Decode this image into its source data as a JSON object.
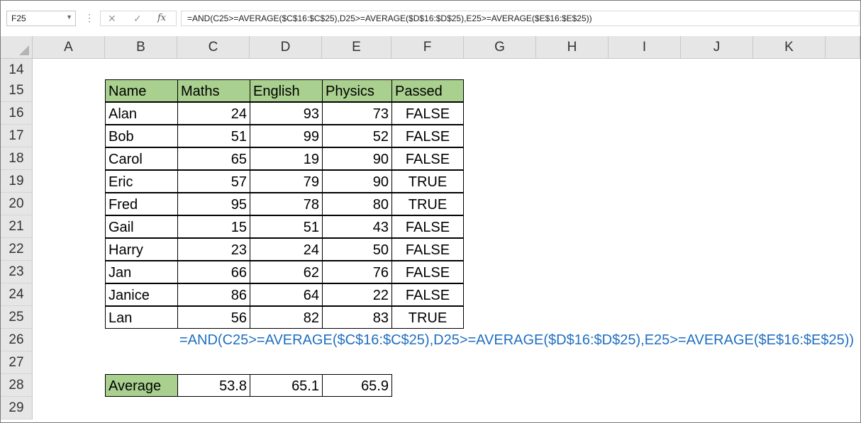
{
  "formula_bar": {
    "name_box": "F25",
    "cancel_glyph": "✕",
    "enter_glyph": "✓",
    "fx_label": "fx",
    "formula": "=AND(C25>=AVERAGE($C$16:$C$25),D25>=AVERAGE($D$16:$D$25),E25>=AVERAGE($E$16:$E$25))"
  },
  "columns": [
    "A",
    "B",
    "C",
    "D",
    "E",
    "F",
    "G",
    "H",
    "I",
    "J",
    "K"
  ],
  "rows": [
    "14",
    "15",
    "16",
    "17",
    "18",
    "19",
    "20",
    "21",
    "22",
    "23",
    "24",
    "25",
    "26",
    "27",
    "28",
    "29"
  ],
  "table": {
    "headers": [
      "Name",
      "Maths",
      "English",
      "Physics",
      "Passed"
    ],
    "rows": [
      [
        "Alan",
        "24",
        "93",
        "73",
        "FALSE"
      ],
      [
        "Bob",
        "51",
        "99",
        "52",
        "FALSE"
      ],
      [
        "Carol",
        "65",
        "19",
        "90",
        "FALSE"
      ],
      [
        "Eric",
        "57",
        "79",
        "90",
        "TRUE"
      ],
      [
        "Fred",
        "95",
        "78",
        "80",
        "TRUE"
      ],
      [
        "Gail",
        "15",
        "51",
        "43",
        "FALSE"
      ],
      [
        "Harry",
        "23",
        "24",
        "50",
        "FALSE"
      ],
      [
        "Jan",
        "66",
        "62",
        "76",
        "FALSE"
      ],
      [
        "Janice",
        "86",
        "64",
        "22",
        "FALSE"
      ],
      [
        "Lan",
        "56",
        "82",
        "83",
        "TRUE"
      ]
    ]
  },
  "formula_note": "=AND(C25>=AVERAGE($C$16:$C$25),D25>=AVERAGE($D$16:$D$25),E25>=AVERAGE($E$16:$E$25))",
  "average_row": {
    "label": "Average",
    "values": [
      "53.8",
      "65.1",
      "65.9"
    ]
  },
  "colors": {
    "header_fill": "#a9d08e",
    "note_text": "#1f6fc0",
    "grid_header_bg": "#e6e6e6"
  }
}
